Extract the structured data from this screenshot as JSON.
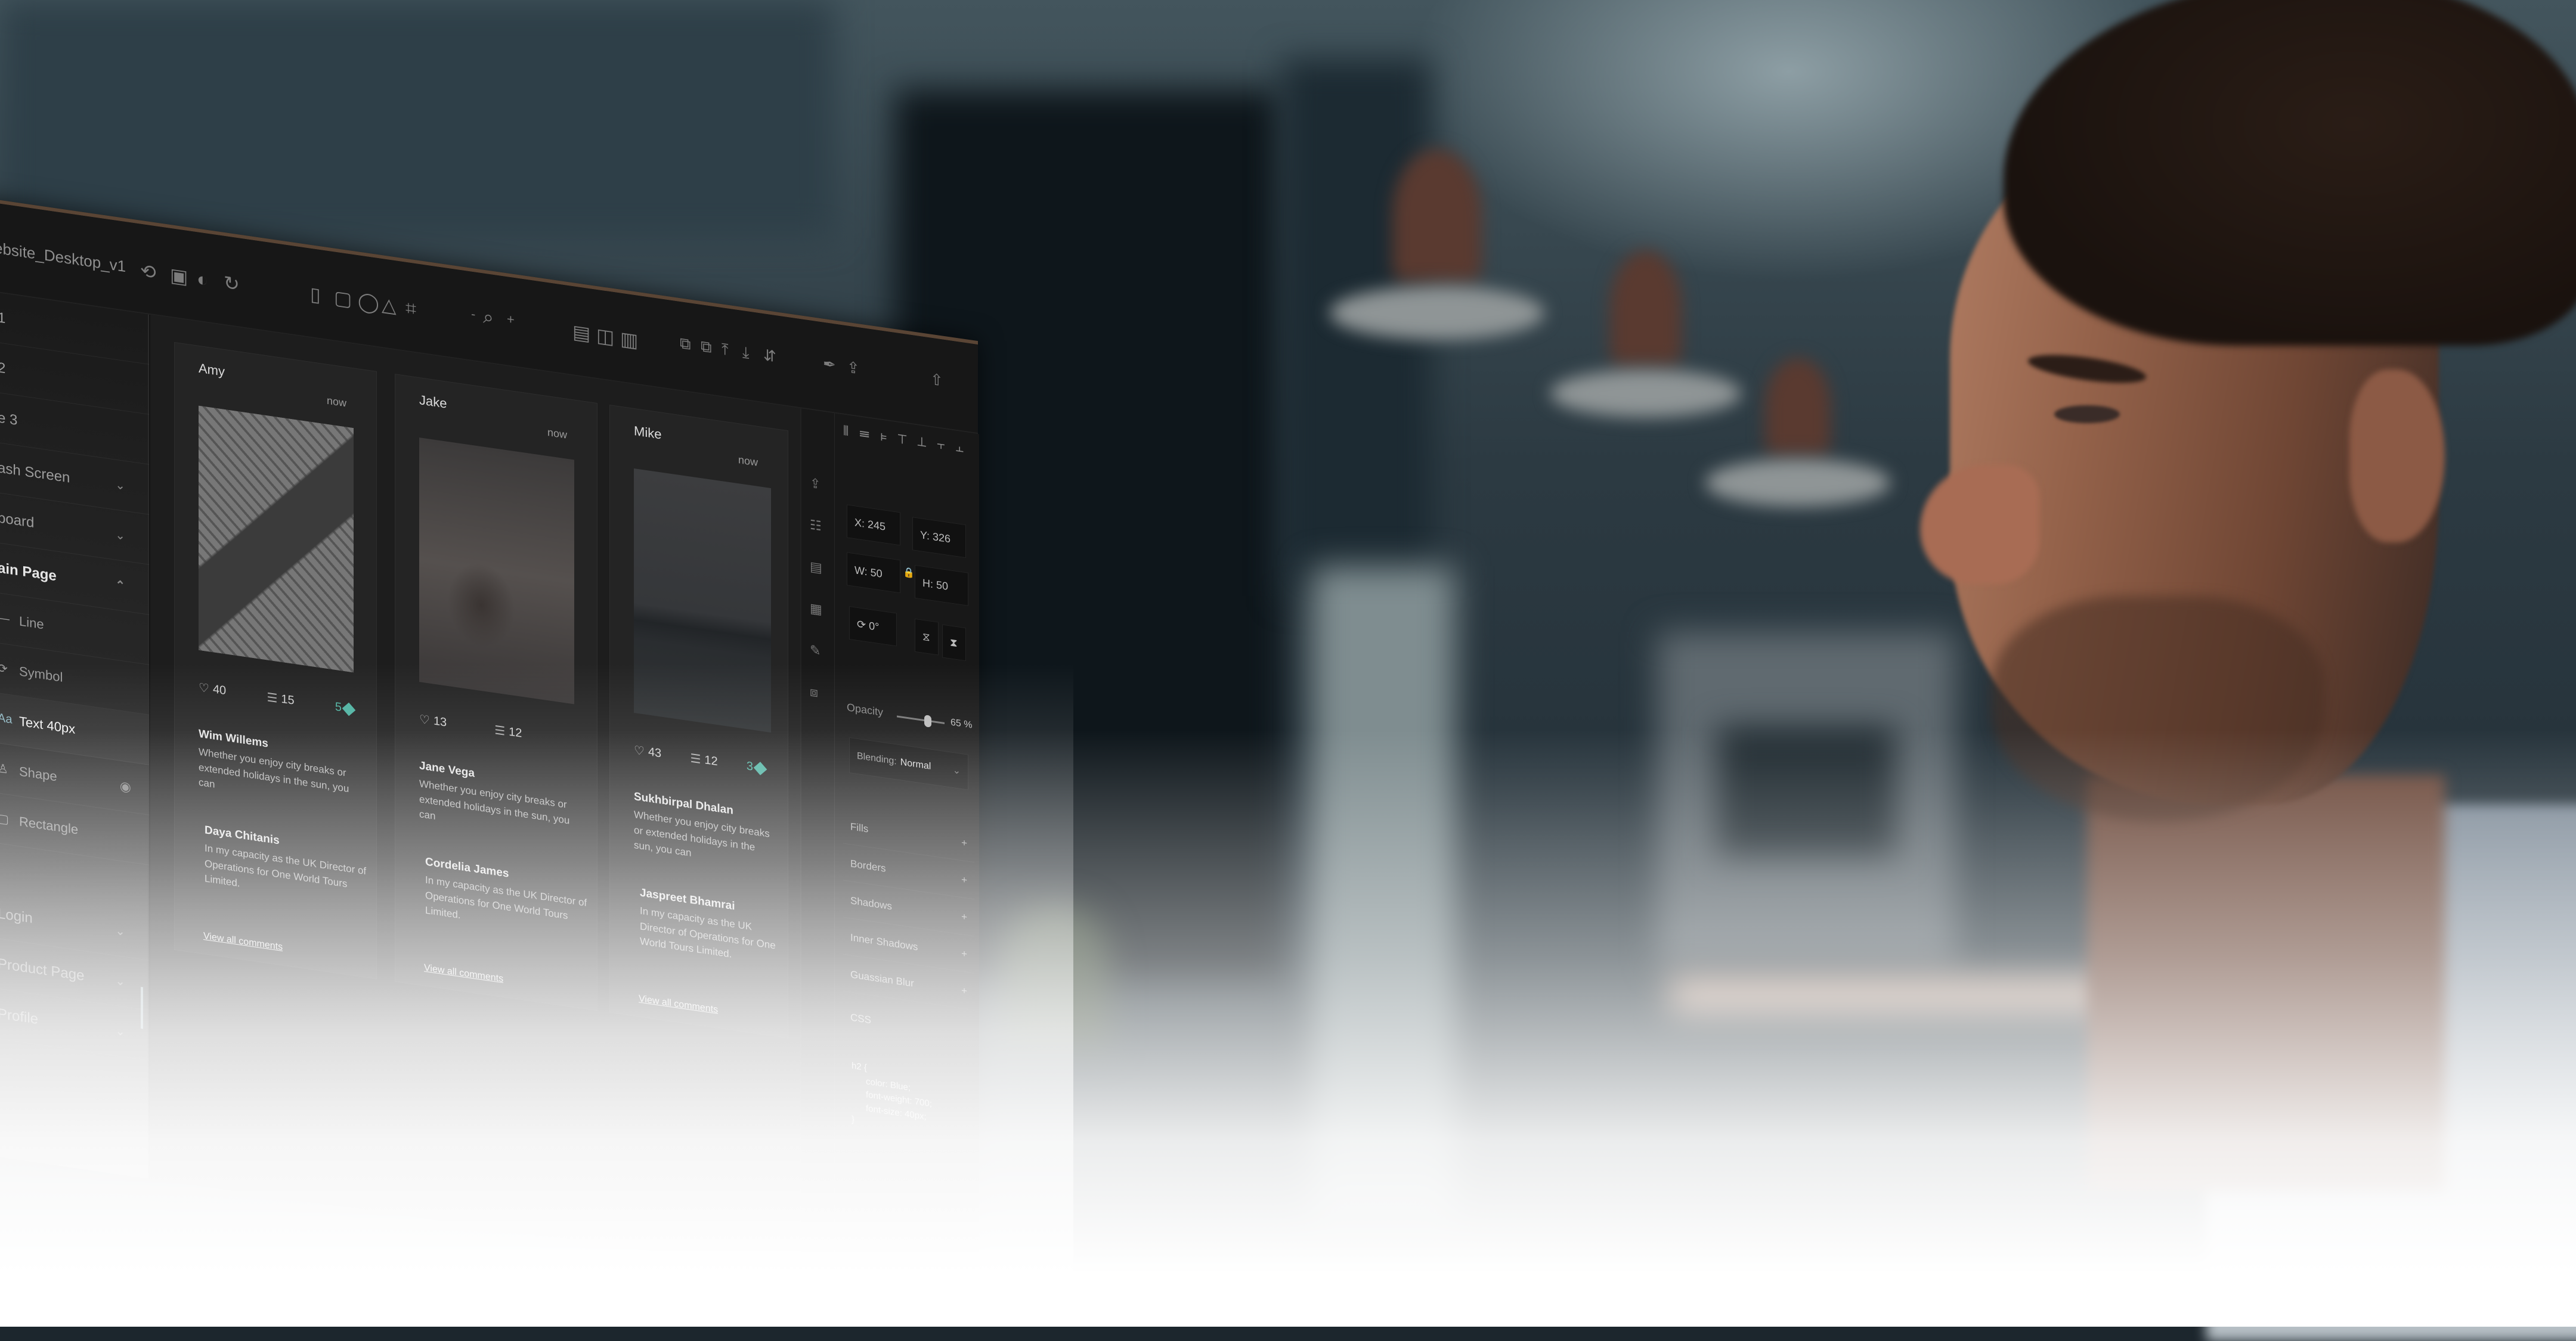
{
  "scene": {
    "description": "Man in profile looking at a monitor showing a dark design-tool UI, blurred interior background, white fade at bottom",
    "colors": {
      "accent_teal": "#4fb3a2",
      "selection_blue": "#8fb7c2",
      "monitor_bg": "#141414"
    }
  },
  "app": {
    "file_name": "ebsite_Desktop_v1",
    "toolbar_icons": [
      "symbol-add-icon",
      "image-icon",
      "mask-icon",
      "refresh-icon",
      "rectangle-icon",
      "rounded-rectangle-icon",
      "ellipse-icon",
      "triangle-icon",
      "artboard-icon",
      "zoom-out-icon",
      "search-icon",
      "zoom-in-icon",
      "grid-icon",
      "layout-icon",
      "columns-icon",
      "group-icon",
      "ungroup-icon",
      "bring-forward-icon",
      "send-backward-icon",
      "flip-icon",
      "pen-icon",
      "upload-icon",
      "export-icon"
    ],
    "zoom_minus": "-",
    "zoom_plus": "+"
  },
  "sidebar": {
    "items": [
      {
        "label": "1",
        "type": "page"
      },
      {
        "label": "2",
        "type": "page"
      },
      {
        "label": "e 3",
        "type": "page"
      },
      {
        "label": "ash Screen",
        "type": "group",
        "expanded": false
      },
      {
        "label": "board",
        "type": "group",
        "expanded": false
      },
      {
        "label": "ain Page",
        "type": "group",
        "expanded": true,
        "active": true
      }
    ],
    "layers": [
      {
        "label": "Line",
        "icon": "line-icon",
        "glyph": "—"
      },
      {
        "label": "Symbol",
        "icon": "symbol-icon",
        "glyph": "⟳"
      },
      {
        "label": "Text 40px",
        "icon": "text-icon",
        "glyph": "Aa",
        "selected": true
      },
      {
        "label": "Shape",
        "icon": "shape-icon",
        "glyph": "♙",
        "visibility_icon": "◉"
      },
      {
        "label": "Rectangle",
        "icon": "rectangle-icon",
        "glyph": "▢"
      }
    ],
    "groups_after": [
      {
        "label": "Login"
      },
      {
        "label": "Product Page"
      },
      {
        "label": "Profile"
      }
    ],
    "collapse_glyph": "⌃",
    "expand_glyph": "⌄"
  },
  "cards": [
    {
      "user": "Amy",
      "time": "now",
      "photo": "eiffel",
      "likes": "40",
      "comments": "15",
      "badge": "5",
      "comments_list": [
        {
          "author": "Wim Willems",
          "text": "Whether you enjoy city breaks or extended holidays in the sun, you can"
        },
        {
          "author": "Daya Chitanis",
          "text": "In my capacity as the UK Director of Operations for One World Tours Limited."
        }
      ],
      "view_all": "View all comments"
    },
    {
      "user": "Jake",
      "time": "now",
      "photo": "street",
      "likes": "13",
      "comments": "12",
      "badge": "",
      "comments_list": [
        {
          "author": "Jane Vega",
          "text": "Whether you enjoy city breaks or extended holidays in the sun, you can"
        },
        {
          "author": "Cordelia James",
          "text": "In my capacity as the UK Director of Operations for One World Tours Limited."
        }
      ],
      "view_all": "View all comments"
    },
    {
      "user": "Mike",
      "time": "now",
      "photo": "skyline",
      "likes": "43",
      "comments": "12",
      "badge": "3",
      "comments_list": [
        {
          "author": "Sukhbirpal Dhalan",
          "text": "Whether you enjoy city breaks or extended holidays in the sun, you can"
        },
        {
          "author": "Jaspreet Bhamrai",
          "text": "In my capacity as the UK Director of Operations for One World Tours Limited."
        }
      ],
      "view_all": "View all comments"
    }
  ],
  "icons": {
    "heart": "♡",
    "comment": "☰"
  },
  "inspector": {
    "align_glyphs": "⫴ ☰ ⊧ ⊤ ⊥ ⫟ ⫠",
    "x": "X: 245",
    "y": "Y: 326",
    "w": "W: 50",
    "h": "H: 50",
    "lock_glyph": "🔒",
    "rotate": "⟳ 0°",
    "flip_h": "⧖",
    "flip_v": "⧗",
    "opacity_label": "Opacity",
    "opacity_value": "65 %",
    "opacity_fraction": 0.65,
    "blending_label": "Blending:",
    "blending_value": "Normal",
    "sections": [
      "Fills",
      "Borders",
      "Shadows",
      "Inner Shadows",
      "Guassian Blur"
    ],
    "plus": "+",
    "css_label": "CSS",
    "css_lines": [
      "h2 {",
      "color: Blue;",
      "font-weight: 700;",
      "font-size: 40px;",
      "}"
    ]
  }
}
